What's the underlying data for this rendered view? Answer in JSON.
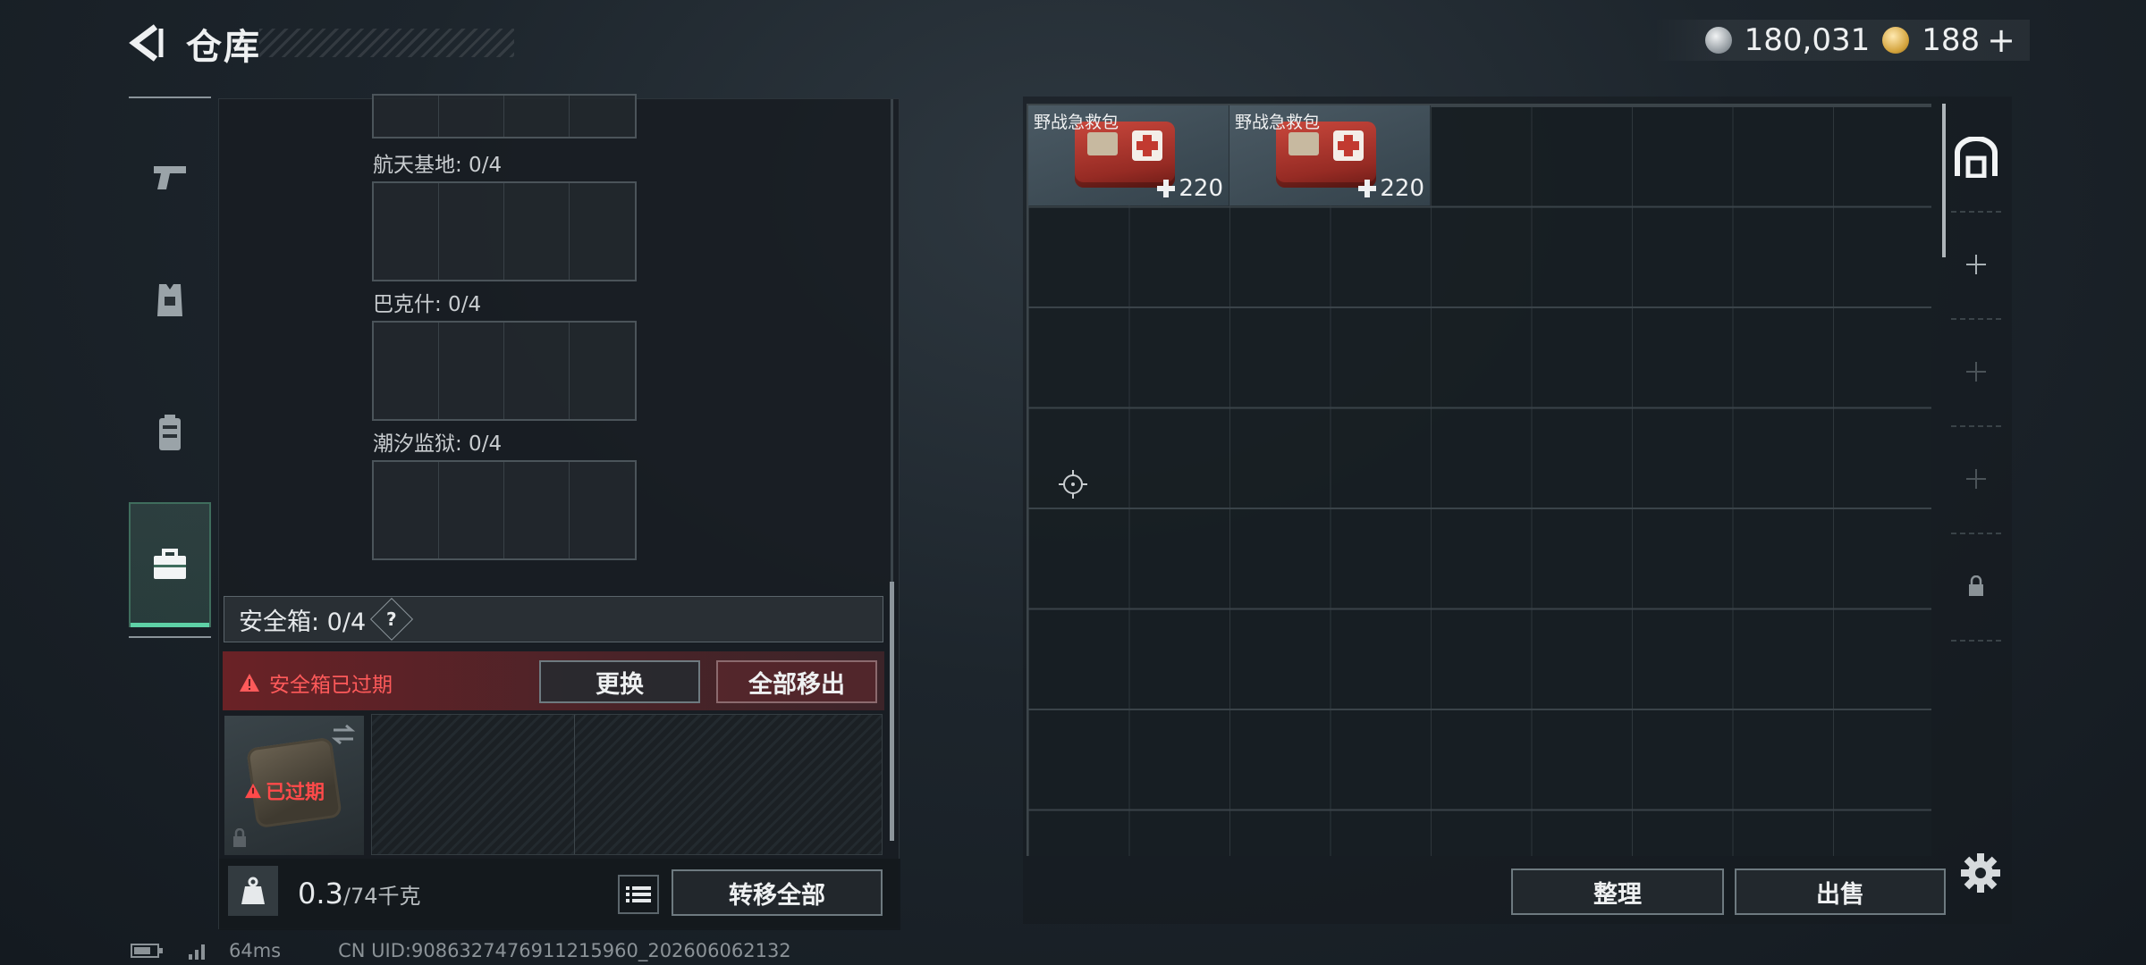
{
  "header": {
    "title": "仓库"
  },
  "currency": {
    "silver": "180,031",
    "gold": "188",
    "plus": "+"
  },
  "left_panel": {
    "maps": [
      {
        "label": "航天基地: 0/4"
      },
      {
        "label": "巴克什: 0/4"
      },
      {
        "label": "潮汐监狱: 0/4"
      }
    ],
    "safe_box": {
      "title": "安全箱: 0/4",
      "help": "?",
      "warning": "安全箱已过期",
      "replace_label": "更换",
      "move_all_label": "全部移出",
      "expired_tag": "已过期"
    },
    "bottom": {
      "weight_current": "0.3",
      "weight_max": "/74千克",
      "transfer_label": "转移全部"
    }
  },
  "storage": {
    "items": [
      {
        "name": "野战急救包",
        "value": "220"
      },
      {
        "name": "野战急救包",
        "value": "220"
      }
    ],
    "sort_label": "整理",
    "sell_label": "出售"
  },
  "footer": {
    "ping": "64ms",
    "uid": "CN UID:9086327476911215960_202606062132"
  },
  "colors": {
    "accent_green": "#5ed1a6",
    "warning_red": "#ff5a5a"
  }
}
